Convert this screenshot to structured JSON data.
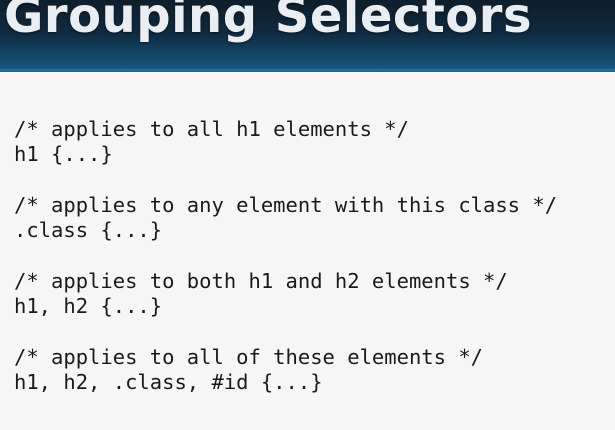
{
  "slide": {
    "title": "Grouping Selectors",
    "examples": [
      {
        "comment": "/* applies to all h1 elements */",
        "code": "h1 {...}"
      },
      {
        "comment": "/* applies to any element with this class */",
        "code": ".class {...}"
      },
      {
        "comment": "/* applies to both h1 and h2 elements */",
        "code": "h1, h2 {...}"
      },
      {
        "comment": "/* applies to all of these elements */",
        "code": "h1, h2, .class, #id {...}"
      }
    ]
  }
}
